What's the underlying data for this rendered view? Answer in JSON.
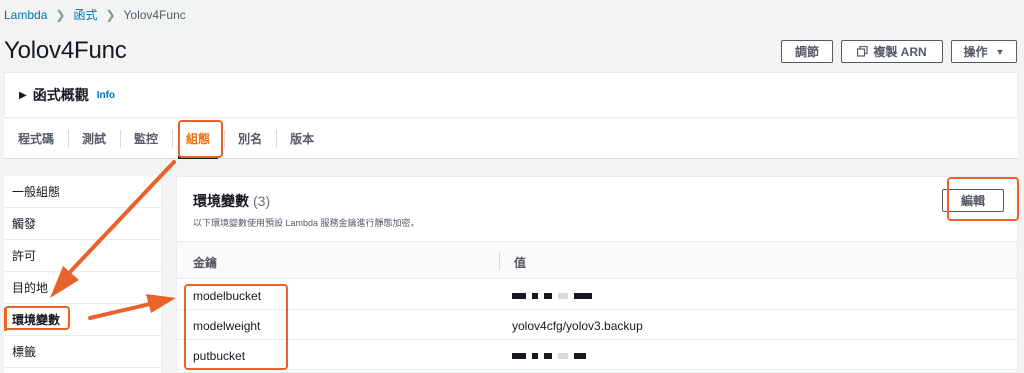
{
  "breadcrumb": {
    "items": [
      "Lambda",
      "函式",
      "Yolov4Func"
    ]
  },
  "page": {
    "title": "Yolov4Func"
  },
  "header_actions": {
    "throttle": "調節",
    "copy_arn": "複製 ARN",
    "actions": "操作"
  },
  "overview": {
    "title": "函式概觀",
    "info": "Info"
  },
  "tabs": [
    "程式碼",
    "測試",
    "監控",
    "組態",
    "別名",
    "版本"
  ],
  "active_tab": "組態",
  "sidebar": {
    "items": [
      "一般組態",
      "觸發",
      "許可",
      "目的地",
      "環境變數",
      "標籤"
    ],
    "active": "環境變數"
  },
  "env_panel": {
    "title": "環境變數",
    "count": "(3)",
    "description": "以下環境變數使用預設 Lambda 服務金鑰進行靜態加密。",
    "edit": "編輯",
    "columns": {
      "key": "金鑰",
      "value": "值"
    },
    "rows": [
      {
        "key": "modelbucket",
        "value": "",
        "masked": true
      },
      {
        "key": "modelweight",
        "value": "yolov4cfg/yolov3.backup",
        "masked": false
      },
      {
        "key": "putbucket",
        "value": "",
        "masked": true
      }
    ]
  },
  "colors": {
    "accent": "#ec7211",
    "link": "#0073bb",
    "annotation": "#e8622c"
  }
}
